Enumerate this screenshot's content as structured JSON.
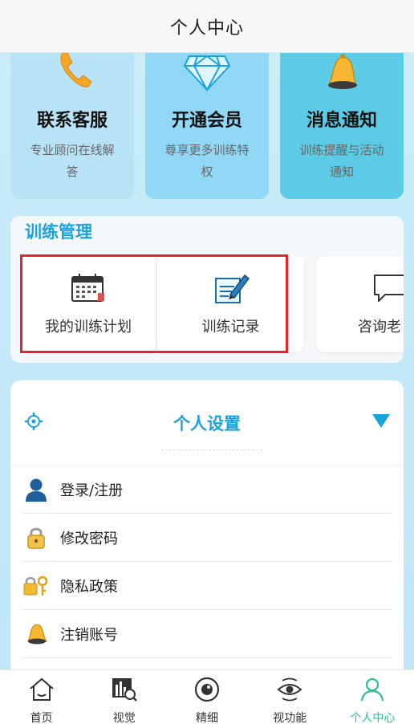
{
  "header": {
    "title": "个人中心"
  },
  "services": [
    {
      "title": "联系客服",
      "desc": "专业顾问在线解答",
      "icon": "phone-icon"
    },
    {
      "title": "开通会员",
      "desc": "尊享更多训练特权",
      "icon": "diamond-icon"
    },
    {
      "title": "消息通知",
      "desc": "训练提醒与活动通知",
      "icon": "bell-icon"
    }
  ],
  "training": {
    "title": "训练管理",
    "items": [
      {
        "label": "我的训练计划",
        "icon": "calendar-icon"
      },
      {
        "label": "训练记录",
        "icon": "notepad-pen-icon"
      },
      {
        "label": "咨询老",
        "icon": "chat-bubble-icon"
      }
    ]
  },
  "settings": {
    "title": "个人设置",
    "items": [
      {
        "label": "登录/注册",
        "icon": "user-icon"
      },
      {
        "label": "修改密码",
        "icon": "padlock-icon"
      },
      {
        "label": "隐私政策",
        "icon": "lock-key-icon"
      },
      {
        "label": "注销账号",
        "icon": "bell-icon"
      }
    ]
  },
  "nav": {
    "items": [
      {
        "label": "首页",
        "icon": "home-icon"
      },
      {
        "label": "视觉",
        "icon": "chart-search-icon"
      },
      {
        "label": "精细",
        "icon": "eye-circle-icon"
      },
      {
        "label": "视功能",
        "icon": "eye-rotate-icon"
      },
      {
        "label": "个人中心",
        "icon": "person-icon",
        "active": true
      }
    ]
  },
  "colors": {
    "accent": "#1aa3dc",
    "active_nav": "#2bbf8f",
    "highlight": "#e0262f"
  }
}
